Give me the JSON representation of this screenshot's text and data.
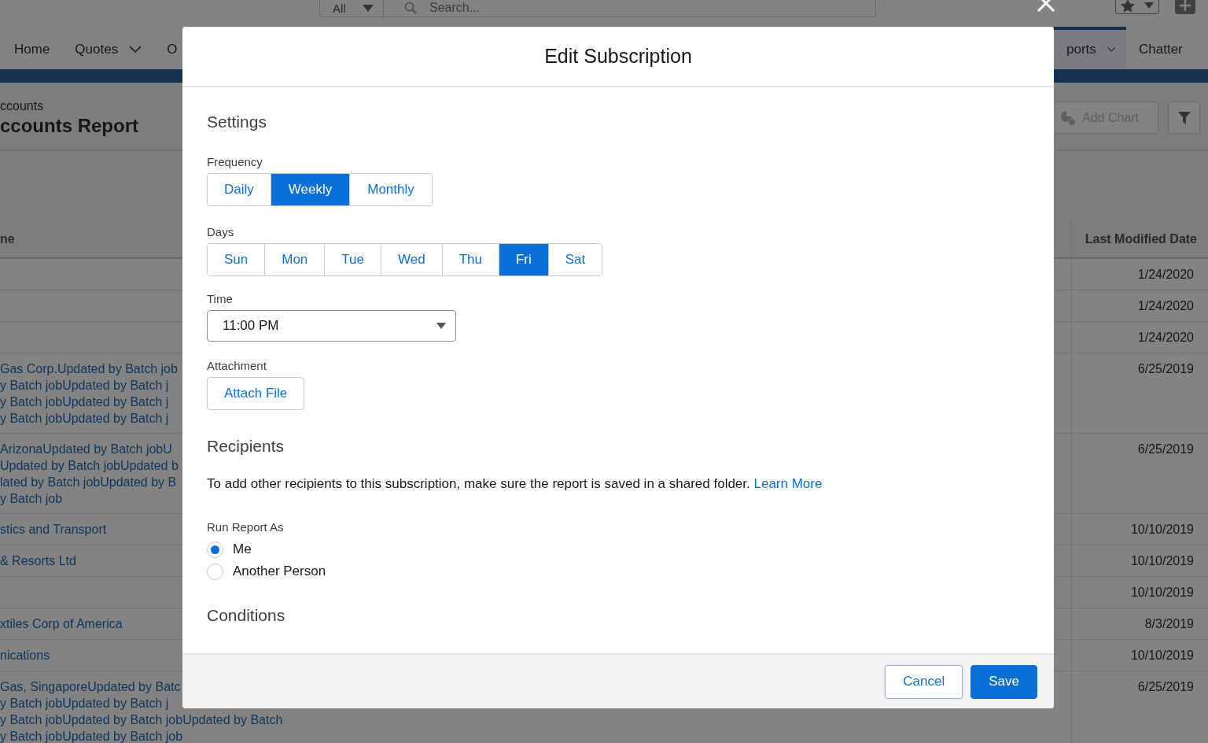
{
  "global_header": {
    "scope_dropdown": "All",
    "search": {
      "placeholder": "Search..."
    }
  },
  "nav_tabs_left": [
    {
      "label": "Home",
      "selected": false,
      "has_menu": false
    },
    {
      "label": "Quotes",
      "selected": false,
      "has_menu": true
    },
    {
      "label": "O",
      "selected": false,
      "has_menu": false
    }
  ],
  "nav_tabs_right": [
    {
      "label": "ports",
      "selected": true,
      "has_menu": true
    },
    {
      "label": "Chatter",
      "selected": false,
      "has_menu": false
    }
  ],
  "report_header": {
    "breadcrumb": "ccounts",
    "title": "ccounts Report",
    "add_chart": {
      "label": "Add Chart",
      "disabled": true
    }
  },
  "table": {
    "columns": [
      "ne",
      "Last Modified Date"
    ],
    "rows": [
      {
        "date": "1/24/2020"
      },
      {
        "date": "1/24/2020"
      },
      {
        "date": "1/24/2020"
      },
      {
        "name_lines": [
          "Gas Corp.Updated by Batch job",
          "y Batch jobUpdated by Batch j",
          "y Batch jobUpdated by Batch j",
          "y Batch jobUpdated by Batch j"
        ],
        "date": "6/25/2019"
      },
      {
        "name_lines": [
          "ArizonaUpdated by Batch jobU",
          "Updated by Batch jobUpdated b",
          "lated by Batch jobUpdated by B",
          "y Batch job"
        ],
        "date": "6/25/2019"
      },
      {
        "name_lines": [
          "stics and Transport"
        ],
        "date": "10/10/2019"
      },
      {
        "name_lines": [
          "& Resorts Ltd"
        ],
        "date": "10/10/2019"
      },
      {
        "date": "10/10/2019"
      },
      {
        "name_lines": [
          "xtiles Corp of America"
        ],
        "date": "8/3/2019"
      },
      {
        "name_lines": [
          "nications"
        ],
        "date": "10/10/2019"
      },
      {
        "name_lines": [
          "Gas, SingaporeUpdated by Batc",
          "y Batch jobUpdated by Batch j",
          "y Batch jobUpdated by Batch jobUpdated by Batch",
          "y Batch jobUpdated by Batch job"
        ],
        "date": "6/25/2019"
      }
    ]
  },
  "modal": {
    "title": "Edit Subscription",
    "settings_heading": "Settings",
    "frequency": {
      "label": "Frequency",
      "options": [
        {
          "label": "Daily",
          "selected": false
        },
        {
          "label": "Weekly",
          "selected": true
        },
        {
          "label": "Monthly",
          "selected": false
        }
      ]
    },
    "days": {
      "label": "Days",
      "options": [
        {
          "label": "Sun",
          "selected": false
        },
        {
          "label": "Mon",
          "selected": false
        },
        {
          "label": "Tue",
          "selected": false
        },
        {
          "label": "Wed",
          "selected": false
        },
        {
          "label": "Thu",
          "selected": false
        },
        {
          "label": "Fri",
          "selected": true
        },
        {
          "label": "Sat",
          "selected": false
        }
      ]
    },
    "time": {
      "label": "Time",
      "value": "11:00 PM"
    },
    "attachment": {
      "label": "Attachment",
      "button": "Attach File"
    },
    "recipients_heading": "Recipients",
    "recipients_text": "To add other recipients to this subscription, make sure the report is saved in a shared folder.",
    "learn_more": "Learn More",
    "run_as": {
      "label": "Run Report As",
      "options": [
        {
          "label": "Me",
          "selected": true
        },
        {
          "label": "Another Person",
          "selected": false
        }
      ]
    },
    "conditions_heading": "Conditions",
    "buttons": [
      {
        "label": "Cancel",
        "kind": "neutral"
      },
      {
        "label": "Save",
        "kind": "brand"
      }
    ]
  }
}
